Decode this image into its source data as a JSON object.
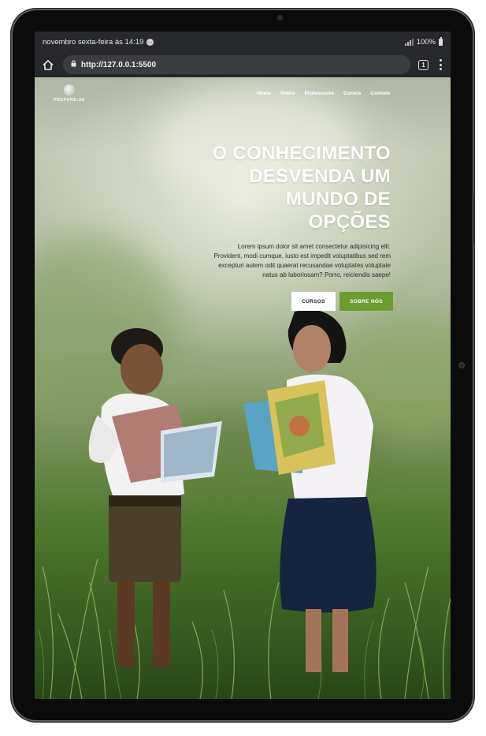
{
  "status_bar": {
    "datetime": "novembro sexta-feira às 14:19",
    "battery": "100%",
    "app_indicator_icon": "message-circle-icon"
  },
  "browser": {
    "url": "http://127.0.0.1:5500",
    "tab_count": "1"
  },
  "site": {
    "brand": "PREPARE-SE",
    "nav": [
      "Home",
      "Sobre",
      "Professores",
      "Cursos",
      "Contato"
    ],
    "hero_title_lines": [
      "O CONHECIMENTO",
      "DESVENDA UM",
      "MUNDO DE",
      "OPÇÕES"
    ],
    "hero_text_lines": [
      "Lorem ipsum dolor sit amet consectetur adipisicing elit.",
      "Provident, modi cumque, iusto est impedit voluptatibus sed rem",
      "excepturi autem odit quaerat recusandae voluptates voluptate",
      "natus ab laboriosam? Porro, reiciendis saepe!"
    ],
    "btn_primary": "CURSOS",
    "btn_secondary": "SOBRE NÓS",
    "accent_color": "#6a9c30"
  }
}
